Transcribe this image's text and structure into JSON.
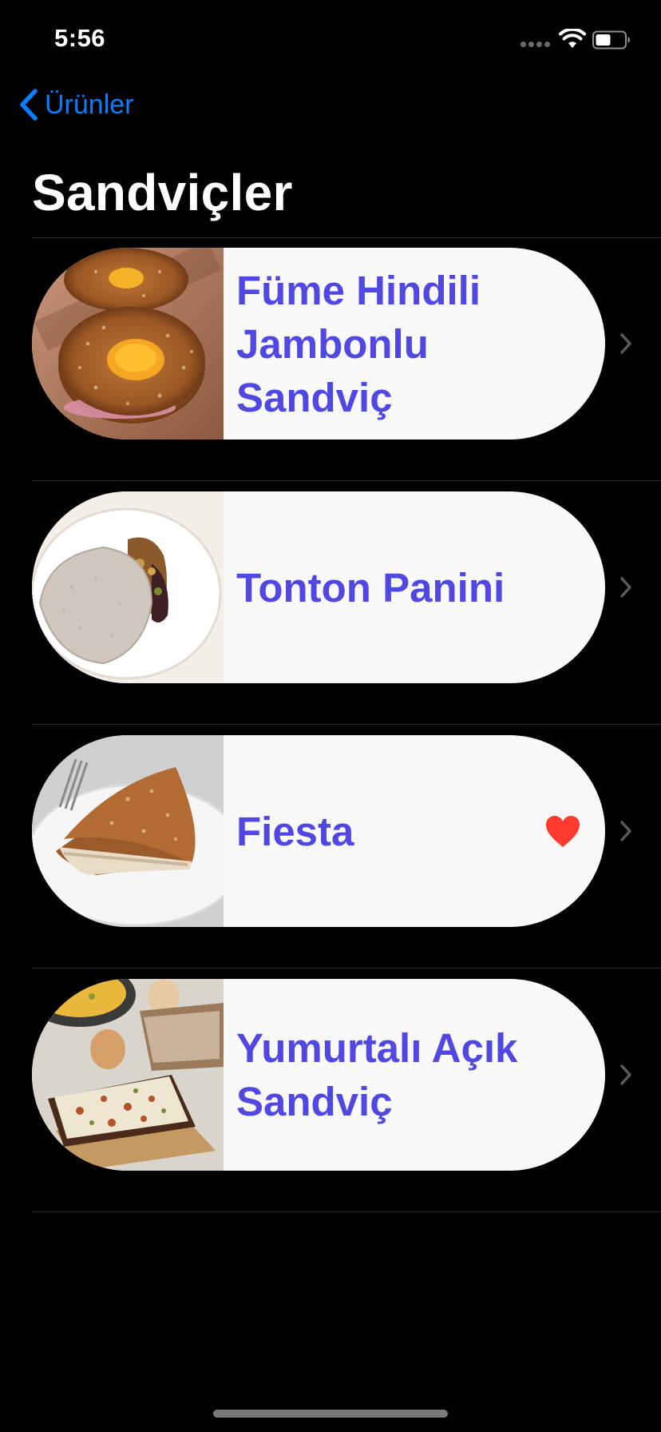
{
  "status_bar": {
    "time": "5:56",
    "icons": [
      "cellular-signal-icon",
      "wifi-icon",
      "battery-icon"
    ]
  },
  "nav": {
    "back_label": "Ürünler",
    "back_icon": "chevron-left-icon"
  },
  "page": {
    "title": "Sandviçler"
  },
  "items": [
    {
      "title": "Füme Hindili Jambonlu Sandviç",
      "image": "smoked-turkey-bagel-sandwich-photo",
      "favorite": false
    },
    {
      "title": "Tonton Panini",
      "image": "tonton-panini-photo",
      "favorite": false
    },
    {
      "title": "Fiesta",
      "image": "fiesta-sandwich-photo",
      "favorite": true
    },
    {
      "title": "Yumurtalı Açık Sandviç",
      "image": "egg-open-sandwich-photo",
      "favorite": false
    }
  ],
  "colors": {
    "background": "#000000",
    "accent": "#0a7cff",
    "item_title": "#5148e3",
    "card": "#f9f9f9",
    "favorite": "#ff3b30",
    "chevron": "#5a5a5e"
  }
}
